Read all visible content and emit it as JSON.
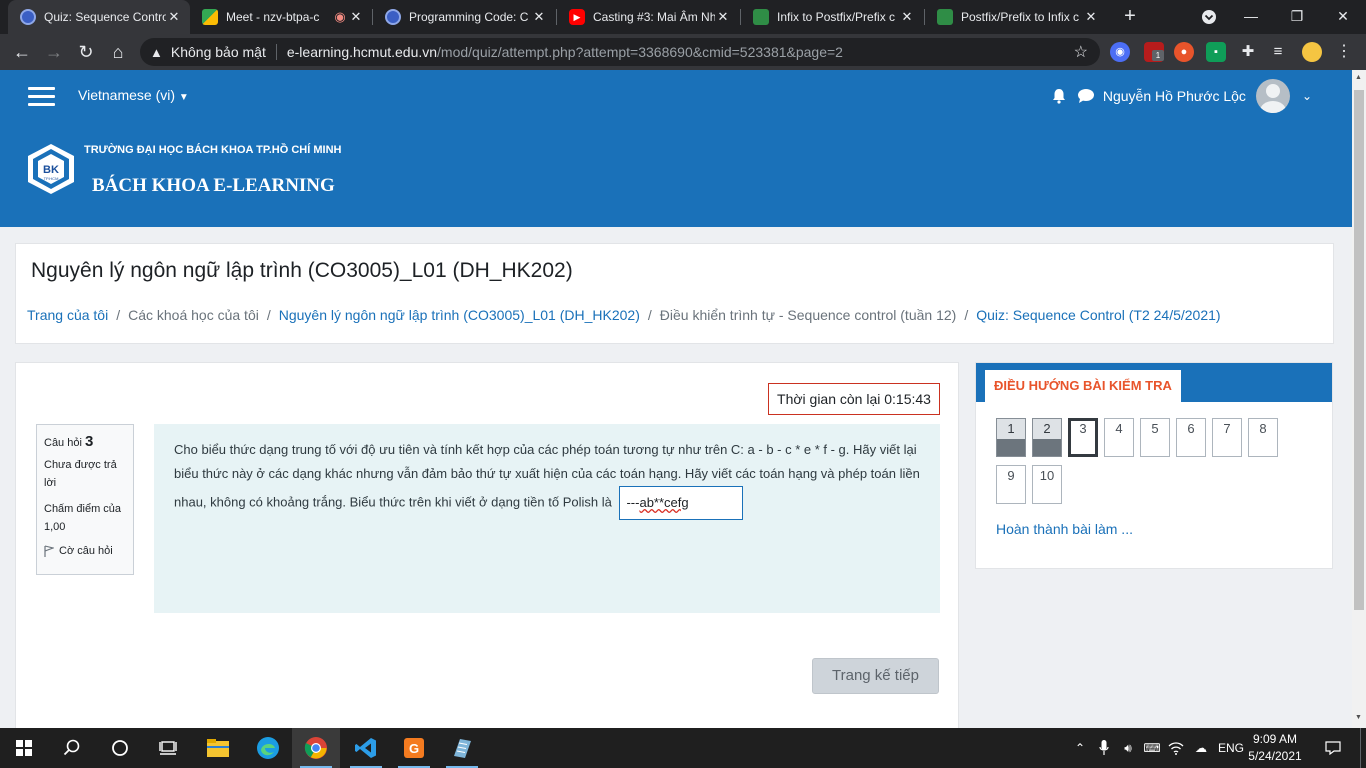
{
  "browser": {
    "tabs": [
      {
        "title": "Quiz: Sequence Contro",
        "favicon": "moodle-icon",
        "active": true
      },
      {
        "title": "Meet - nzv-btpa-c",
        "favicon": "meet-icon",
        "active": false
      },
      {
        "title": "Programming Code: C",
        "favicon": "moodle-icon",
        "active": false
      },
      {
        "title": "Casting #3: Mai Âm Nh",
        "favicon": "youtube-icon",
        "active": false
      },
      {
        "title": "Infix to Postfix/Prefix c",
        "favicon": "gfg-icon",
        "active": false
      },
      {
        "title": "Postfix/Prefix to Infix c",
        "favicon": "gfg-icon",
        "active": false
      }
    ],
    "security_label": "Không bảo mật",
    "url_host": "e-learning.hcmut.edu.vn",
    "url_path": "/mod/quiz/attempt.php?attempt=3368690&cmid=523381&page=2",
    "ext_badge": "1"
  },
  "navbar": {
    "language": "Vietnamese (vi)",
    "user_name": "Nguyễn Hồ Phước Lộc"
  },
  "banner": {
    "university": "TRƯỜNG ĐẠI HỌC BÁCH KHOA TP.HỒ CHÍ MINH",
    "site_name": "BÁCH KHOA E-LEARNING",
    "logo_text": "BK",
    "logo_subtext": "TP.HCM"
  },
  "course": {
    "title": "Nguyên lý ngôn ngữ lập trình (CO3005)_L01 (DH_HK202)",
    "breadcrumb": [
      {
        "label": "Trang của tôi",
        "link": true
      },
      {
        "label": "Các khoá học của tôi",
        "link": false
      },
      {
        "label": "Nguyên lý ngôn ngữ lập trình (CO3005)_L01 (DH_HK202)",
        "link": true
      },
      {
        "label": "Điều khiển trình tự - Sequence control (tuần 12)",
        "link": false
      },
      {
        "label": "Quiz: Sequence Control (T2 24/5/2021)",
        "link": true
      }
    ]
  },
  "quiz": {
    "timer": "Thời gian còn lại 0:15:43",
    "question_label": "Câu hỏi",
    "question_number": "3",
    "state": "Chưa được trả lời",
    "grade": "Chấm điểm của 1,00",
    "flag": "Cờ câu hỏi",
    "question_text": "Cho biểu thức dạng trung tố với độ ưu tiên và tính kết hợp của các phép toán tương tự như trên C: a - b -  c * e * f  - g. Hãy viết lại biểu thức này ở các dạng khác nhưng vẫn đảm bảo thứ tự xuất hiện của các toán hạng. Hãy viết các toán hạng và phép toán liền nhau, không có khoảng trắng. Biểu thức trên khi viết ở dạng tiền tố Polish là",
    "answer_prefix": "---",
    "answer_typed": "ab**cefg",
    "next_button": "Trang kế tiếp"
  },
  "quiz_nav": {
    "title": "ĐIỀU HƯỚNG BÀI KIỂM TRA",
    "questions": [
      {
        "label": "1",
        "state": "answered"
      },
      {
        "label": "2",
        "state": "answered"
      },
      {
        "label": "3",
        "state": "current"
      },
      {
        "label": "4",
        "state": "notyet"
      },
      {
        "label": "5",
        "state": "notyet"
      },
      {
        "label": "6",
        "state": "notyet"
      },
      {
        "label": "7",
        "state": "notyet"
      },
      {
        "label": "8",
        "state": "notyet"
      },
      {
        "label": "9",
        "state": "notyet"
      },
      {
        "label": "10",
        "state": "notyet"
      }
    ],
    "finish_link": "Hoàn thành bài làm ..."
  },
  "taskbar": {
    "language": "ENG",
    "time": "9:09 AM",
    "date": "5/24/2021"
  },
  "colors": {
    "brand_blue": "#1a71b9",
    "nav_title_orange": "#e8542b",
    "timer_border": "#ca3120",
    "question_bg": "#e7f3f5"
  }
}
